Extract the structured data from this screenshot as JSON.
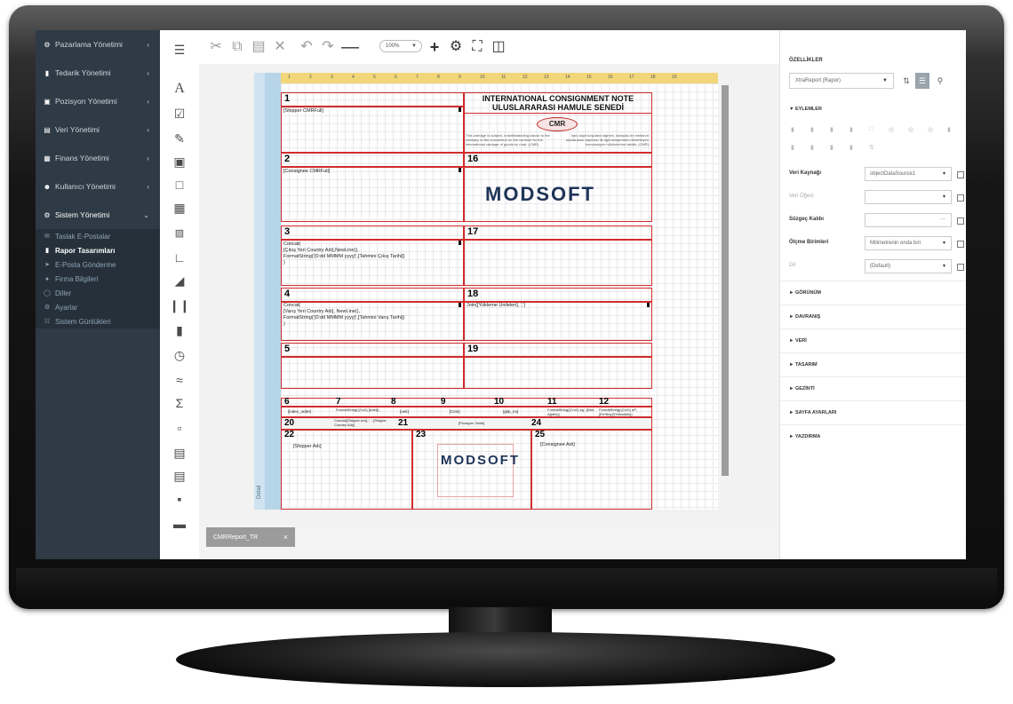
{
  "sidebar": {
    "menu": [
      {
        "label": "Pazarlama Yönetimi",
        "icon": "users-cog-icon"
      },
      {
        "label": "Tedarik Yönetimi",
        "icon": "bar-chart-icon"
      },
      {
        "label": "Pozisyon Yönetimi",
        "icon": "briefcase-icon"
      },
      {
        "label": "Veri Yönetimi",
        "icon": "database-icon"
      },
      {
        "label": "Finans Yönetimi",
        "icon": "money-icon"
      },
      {
        "label": "Kullanıcı Yönetimi",
        "icon": "users-icon"
      },
      {
        "label": "Sistem Yönetimi",
        "icon": "cogs-icon"
      }
    ],
    "submenu": [
      {
        "label": "Taslak E-Postalar",
        "icon": "envelope-icon"
      },
      {
        "label": "Rapor Tasarımları",
        "icon": "file-icon"
      },
      {
        "label": "E-Posta Gönderme",
        "icon": "send-icon"
      },
      {
        "label": "Firma Bilgileri",
        "icon": "info-icon"
      },
      {
        "label": "Diller",
        "icon": "globe-icon"
      },
      {
        "label": "Ayarlar",
        "icon": "gear-icon"
      },
      {
        "label": "Sistem Günlükleri",
        "icon": "sitemap-icon"
      }
    ]
  },
  "toolbar": {
    "zoom": "100%"
  },
  "report": {
    "band_labels": {
      "detail": "Detail"
    },
    "header_title_1": "INTERNATIONAL CONSIGNMENT NOTE",
    "header_title_2": "ULUSLARARASI HAMULE SENEDİ",
    "cmr_badge": "CMR",
    "disclaimer_en": "This carriage is subject, notwithstanding clause to the contrary, to the convention on the contract for the international carriage of goods by road. (CMR)",
    "disclaimer_tr": "İşbu kayıt koşulara rağmen, karayolu ile emtianın uluslararası taşıması ile ilgili anlaşmanın düzenleyen konvansiyon hükümlerine tabidir. (CMR)",
    "logo_text": "MODSOFT",
    "field_1": "[Shipper CMRFull]",
    "field_2": "[Consignee CMRFull]",
    "field_3": "Concat(\n[Çıkış Yeri Country Adı],NewLine(),\nFormatString('{0:dd MMMM yyyy}',[Tahmini Çıkış Tarihi])\n)",
    "field_4": "Concat(\n[Varış Yeri Country Adı], NewLine(),\nFormatString('{0:dd MMMM yyyy}',[Tahmini Varış Tarihi])\n)",
    "field_18": "Join([Yükleme Unileleri], ',')",
    "row6": {
      "c6": "[index_order]",
      "c7": "FormatString('{0:n2} [Adet])",
      "c8": "[unit]",
      "c9": "[Cins]",
      "c10": "[gtip_no]",
      "c11": "FormatString('{0:n2} kg', [Brüt Ağırlık])",
      "c12": "FormatString('{0:n2} m³', [En*Boy]*[Yükseklik])"
    },
    "f20": "Concat([Shipper Adı],', ', [Shipper Country Adı])",
    "f24": "[Pozisyon Tarihi]",
    "f22": "[Shipper Adı]",
    "f25": "[Consignee Adı]",
    "ruler_ticks": [
      "1",
      "2",
      "3",
      "4",
      "5",
      "6",
      "7",
      "8",
      "9",
      "10",
      "11",
      "12",
      "13",
      "14",
      "15",
      "16",
      "17",
      "18",
      "19"
    ]
  },
  "panel": {
    "title": "ÖZELLİKLER",
    "object_select": "XtraReport (Rapor)",
    "actions_title": "▼ EYLEMLER",
    "rows": [
      {
        "label": "Veri Kaynağı",
        "value": "objectDataSource1",
        "dim": false,
        "type": "select"
      },
      {
        "label": "Veri Öğesi",
        "value": "",
        "dim": true,
        "type": "select"
      },
      {
        "label": "Süzgeç Kalıbı",
        "value": "",
        "dim": false,
        "type": "dots"
      },
      {
        "label": "Ölçme Birimleri",
        "value": "Milimetrenin onda biri",
        "dim": false,
        "type": "select"
      },
      {
        "label": "Dil",
        "value": "(Default)",
        "dim": true,
        "type": "select"
      }
    ],
    "sections": [
      "► GÖRÜNÜM",
      "► DAVRANIŞ",
      "► VERİ",
      "► TASARIM",
      "► GEZİNTİ",
      "► SAYFA AYARLARI",
      "► YAZDIRMA"
    ]
  },
  "tab": {
    "label": "CMRReport_TR",
    "close": "×"
  }
}
